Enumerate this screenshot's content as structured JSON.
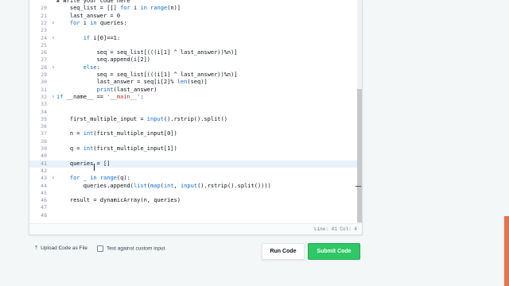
{
  "editor": {
    "lines": [
      {
        "num": "",
        "fold": "",
        "code": "# Write your code here",
        "active": false
      },
      {
        "num": "20",
        "fold": "",
        "code": "    seq_list = [[] for i in range(n)]",
        "active": false
      },
      {
        "num": "21",
        "fold": "",
        "code": "    last_answer = 0",
        "active": false
      },
      {
        "num": "22",
        "fold": "∨",
        "code": "    for i in queries:",
        "active": false
      },
      {
        "num": "23",
        "fold": "",
        "code": "",
        "active": false
      },
      {
        "num": "24",
        "fold": "∨",
        "code": "        if i[0]==1:",
        "active": false
      },
      {
        "num": "25",
        "fold": "",
        "code": "",
        "active": false
      },
      {
        "num": "26",
        "fold": "",
        "code": "            seq = seq_list[(((i[1] ^ last_answer))%n)]",
        "active": false
      },
      {
        "num": "27",
        "fold": "",
        "code": "            seq.append(i[2])",
        "active": false
      },
      {
        "num": "28",
        "fold": "∨",
        "code": "        else:",
        "active": false
      },
      {
        "num": "29",
        "fold": "",
        "code": "            seq = seq_list[(((i[1] ^ last_answer))%n)]",
        "active": false
      },
      {
        "num": "30",
        "fold": "",
        "code": "            last_answer = seq[i[2]% len(seq)]",
        "active": false
      },
      {
        "num": "31",
        "fold": "",
        "code": "            print(last_answer)",
        "active": false
      },
      {
        "num": "32",
        "fold": "∨",
        "code": "if __name__ == '__main__':",
        "active": false
      },
      {
        "num": "33",
        "fold": "",
        "code": "",
        "active": false
      },
      {
        "num": "34",
        "fold": "",
        "code": "",
        "active": false
      },
      {
        "num": "35",
        "fold": "",
        "code": "    first_multiple_input = input().rstrip().split()",
        "active": false
      },
      {
        "num": "36",
        "fold": "",
        "code": "",
        "active": false
      },
      {
        "num": "37",
        "fold": "",
        "code": "    n = int(first_multiple_input[0])",
        "active": false
      },
      {
        "num": "38",
        "fold": "",
        "code": "",
        "active": false
      },
      {
        "num": "39",
        "fold": "",
        "code": "    q = int(first_multiple_input[1])",
        "active": false
      },
      {
        "num": "40",
        "fold": "",
        "code": "",
        "active": false
      },
      {
        "num": "41",
        "fold": "",
        "code": "    queries = []",
        "active": true
      },
      {
        "num": "42",
        "fold": "",
        "code": "",
        "active": false
      },
      {
        "num": "43",
        "fold": "∨",
        "code": "    for _ in range(q):",
        "active": false
      },
      {
        "num": "44",
        "fold": "",
        "code": "        queries.append(list(map(int, input().rstrip().split())))",
        "active": false
      },
      {
        "num": "45",
        "fold": "",
        "code": "",
        "active": false
      },
      {
        "num": "46",
        "fold": "",
        "code": "    result = dynamicArray(n, queries)",
        "active": false
      },
      {
        "num": "47",
        "fold": "",
        "code": "",
        "active": false
      },
      {
        "num": "48",
        "fold": "",
        "code": "",
        "active": false
      }
    ],
    "keywords": [
      "for",
      "in",
      "if",
      "else",
      "range",
      "print",
      "int",
      "input",
      "list",
      "map",
      "len"
    ]
  },
  "status": {
    "cursor_position": "Line: 41 Col: 4"
  },
  "footer": {
    "upload_label": "Upload Code as File",
    "upload_icon": "upload-icon",
    "custom_input_label": "Test against custom input",
    "run_label": "Run Code",
    "submit_label": "Submit Code"
  },
  "colors": {
    "submit_bg": "#2ec866",
    "keyword": "#0d6fd6",
    "string": "#c0392b",
    "active_line": "#e9f1fb"
  }
}
